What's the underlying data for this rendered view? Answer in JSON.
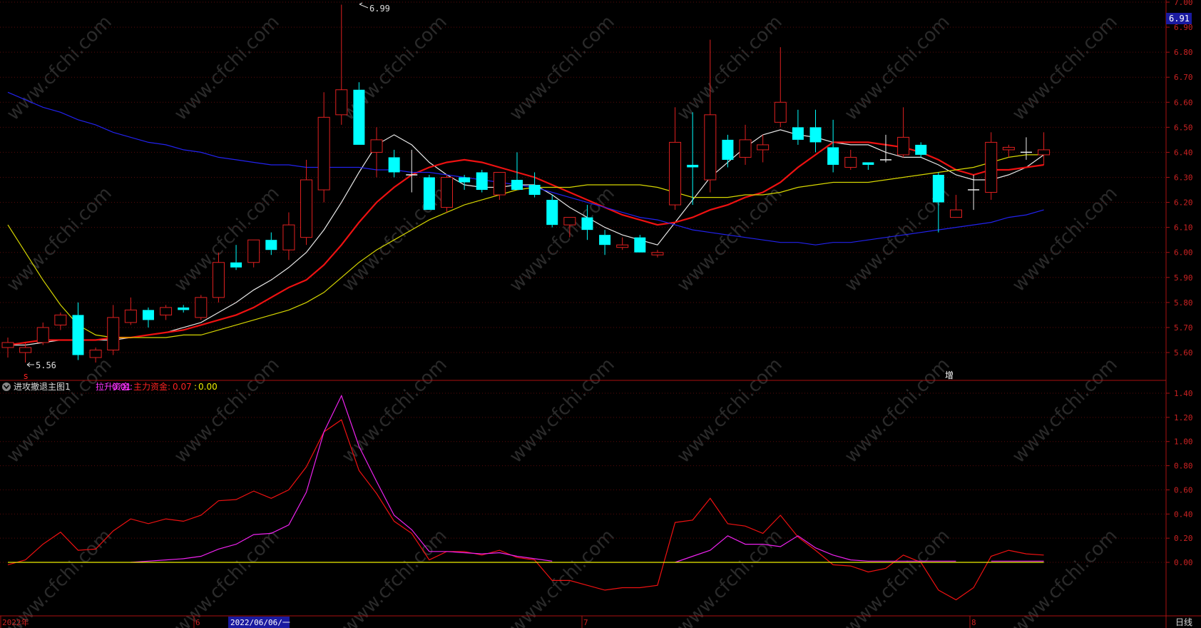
{
  "price_axis": {
    "ticks": [
      "7.00",
      "6.90",
      "6.80",
      "6.70",
      "6.60",
      "6.50",
      "6.40",
      "6.30",
      "6.20",
      "6.10",
      "6.00",
      "5.90",
      "5.80",
      "5.70",
      "5.60"
    ],
    "current_label": "6.91"
  },
  "indicator_axis": {
    "ticks": [
      "1.40",
      "1.20",
      "1.00",
      "0.80",
      "0.60",
      "0.40",
      "0.20",
      "0.00"
    ]
  },
  "annotations": {
    "high_label": "6.99",
    "low_label": "5.56",
    "signal_s": "s",
    "signal_zeng": "增"
  },
  "indicator_header": {
    "name": "进攻撤退主图1",
    "line1_label": "拉升资金:",
    "line1_value": "0.01",
    "line2_label": "主力资金:",
    "line2_value": "0.07",
    "line3_label": ":",
    "line3_value": "0.00"
  },
  "time_axis": {
    "labels": [
      "2022年",
      "6",
      "7",
      "8"
    ],
    "cursor_date": "2022/06/06/一",
    "period": "日线"
  },
  "watermark": "www.cfchi.com",
  "colors": {
    "up": "#e02020",
    "down": "#00ffff",
    "ma_white": "#e8e8e8",
    "ma_red": "#ee1111",
    "ma_yellow": "#d6d600",
    "ma_blue": "#2222ee",
    "ind_magenta": "#ee22ee",
    "ind_red": "#ee1111",
    "ind_yellow": "#eeee00"
  },
  "chart_data": [
    {
      "type": "candlestick",
      "ylim": [
        5.5,
        7.0
      ],
      "candles": [
        {
          "o": 5.62,
          "h": 5.66,
          "l": 5.58,
          "c": 5.64
        },
        {
          "o": 5.6,
          "h": 5.64,
          "l": 5.56,
          "c": 5.62
        },
        {
          "o": 5.64,
          "h": 5.72,
          "l": 5.63,
          "c": 5.7
        },
        {
          "o": 5.71,
          "h": 5.76,
          "l": 5.69,
          "c": 5.75
        },
        {
          "o": 5.75,
          "h": 5.8,
          "l": 5.57,
          "c": 5.59
        },
        {
          "o": 5.58,
          "h": 5.62,
          "l": 5.56,
          "c": 5.61
        },
        {
          "o": 5.61,
          "h": 5.79,
          "l": 5.59,
          "c": 5.74
        },
        {
          "o": 5.72,
          "h": 5.82,
          "l": 5.71,
          "c": 5.77
        },
        {
          "o": 5.77,
          "h": 5.78,
          "l": 5.7,
          "c": 5.73
        },
        {
          "o": 5.75,
          "h": 5.79,
          "l": 5.73,
          "c": 5.78
        },
        {
          "o": 5.78,
          "h": 5.79,
          "l": 5.76,
          "c": 5.77
        },
        {
          "o": 5.74,
          "h": 5.83,
          "l": 5.73,
          "c": 5.82
        },
        {
          "o": 5.82,
          "h": 6.0,
          "l": 5.8,
          "c": 5.96
        },
        {
          "o": 5.96,
          "h": 6.03,
          "l": 5.93,
          "c": 5.94
        },
        {
          "o": 5.96,
          "h": 6.04,
          "l": 5.94,
          "c": 6.05
        },
        {
          "o": 6.05,
          "h": 6.08,
          "l": 5.99,
          "c": 6.01
        },
        {
          "o": 6.01,
          "h": 6.16,
          "l": 5.97,
          "c": 6.11
        },
        {
          "o": 6.06,
          "h": 6.37,
          "l": 6.03,
          "c": 6.29
        },
        {
          "o": 6.25,
          "h": 6.64,
          "l": 6.2,
          "c": 6.54
        },
        {
          "o": 6.55,
          "h": 6.99,
          "l": 6.51,
          "c": 6.65
        },
        {
          "o": 6.65,
          "h": 6.68,
          "l": 6.43,
          "c": 6.43
        },
        {
          "o": 6.4,
          "h": 6.5,
          "l": 6.3,
          "c": 6.45
        },
        {
          "o": 6.38,
          "h": 6.41,
          "l": 6.3,
          "c": 6.32
        },
        {
          "o": 6.31,
          "h": 6.41,
          "l": 6.24,
          "c": 6.31
        },
        {
          "o": 6.3,
          "h": 6.31,
          "l": 6.17,
          "c": 6.17
        },
        {
          "o": 6.18,
          "h": 6.31,
          "l": 6.16,
          "c": 6.3
        },
        {
          "o": 6.3,
          "h": 6.31,
          "l": 6.25,
          "c": 6.28
        },
        {
          "o": 6.32,
          "h": 6.33,
          "l": 6.24,
          "c": 6.25
        },
        {
          "o": 6.23,
          "h": 6.32,
          "l": 6.21,
          "c": 6.32
        },
        {
          "o": 6.29,
          "h": 6.4,
          "l": 6.26,
          "c": 6.25
        },
        {
          "o": 6.27,
          "h": 6.32,
          "l": 6.22,
          "c": 6.23
        },
        {
          "o": 6.21,
          "h": 6.23,
          "l": 6.1,
          "c": 6.11
        },
        {
          "o": 6.11,
          "h": 6.14,
          "l": 6.06,
          "c": 6.14
        },
        {
          "o": 6.14,
          "h": 6.19,
          "l": 6.05,
          "c": 6.09
        },
        {
          "o": 6.07,
          "h": 6.09,
          "l": 5.99,
          "c": 6.03
        },
        {
          "o": 6.02,
          "h": 6.06,
          "l": 6.01,
          "c": 6.03
        },
        {
          "o": 6.06,
          "h": 6.07,
          "l": 6.0,
          "c": 6.0
        },
        {
          "o": 5.99,
          "h": 6.01,
          "l": 5.98,
          "c": 6.0
        },
        {
          "o": 6.19,
          "h": 6.58,
          "l": 6.17,
          "c": 6.44
        },
        {
          "o": 6.35,
          "h": 6.56,
          "l": 6.19,
          "c": 6.34
        },
        {
          "o": 6.29,
          "h": 6.85,
          "l": 6.24,
          "c": 6.55
        },
        {
          "o": 6.45,
          "h": 6.47,
          "l": 6.34,
          "c": 6.37
        },
        {
          "o": 6.38,
          "h": 6.51,
          "l": 6.35,
          "c": 6.45
        },
        {
          "o": 6.41,
          "h": 6.47,
          "l": 6.36,
          "c": 6.43
        },
        {
          "o": 6.52,
          "h": 6.82,
          "l": 6.5,
          "c": 6.6
        },
        {
          "o": 6.5,
          "h": 6.57,
          "l": 6.43,
          "c": 6.45
        },
        {
          "o": 6.5,
          "h": 6.57,
          "l": 6.4,
          "c": 6.44
        },
        {
          "o": 6.42,
          "h": 6.53,
          "l": 6.32,
          "c": 6.35
        },
        {
          "o": 6.34,
          "h": 6.41,
          "l": 6.33,
          "c": 6.38
        },
        {
          "o": 6.36,
          "h": 6.36,
          "l": 6.33,
          "c": 6.35
        },
        {
          "o": 6.37,
          "h": 6.47,
          "l": 6.36,
          "c": 6.37
        },
        {
          "o": 6.39,
          "h": 6.58,
          "l": 6.38,
          "c": 6.46
        },
        {
          "o": 6.43,
          "h": 6.44,
          "l": 6.38,
          "c": 6.39
        },
        {
          "o": 6.31,
          "h": 6.32,
          "l": 6.08,
          "c": 6.2
        },
        {
          "o": 6.14,
          "h": 6.23,
          "l": 6.14,
          "c": 6.17
        },
        {
          "o": 6.25,
          "h": 6.31,
          "l": 6.17,
          "c": 6.25
        },
        {
          "o": 6.24,
          "h": 6.48,
          "l": 6.21,
          "c": 6.44
        },
        {
          "o": 6.41,
          "h": 6.43,
          "l": 6.38,
          "c": 6.42
        },
        {
          "o": 6.4,
          "h": 6.46,
          "l": 6.37,
          "c": 6.4
        },
        {
          "o": 6.39,
          "h": 6.48,
          "l": 6.35,
          "c": 6.41
        }
      ],
      "ma_series": [
        {
          "color_key": "ma_white",
          "values": [
            5.63,
            5.63,
            5.64,
            5.65,
            5.65,
            5.65,
            5.65,
            5.66,
            5.67,
            5.68,
            5.7,
            5.72,
            5.76,
            5.8,
            5.85,
            5.89,
            5.94,
            6.0,
            6.09,
            6.2,
            6.32,
            6.43,
            6.47,
            6.43,
            6.36,
            6.31,
            6.27,
            6.26,
            6.26,
            6.27,
            6.27,
            6.23,
            6.18,
            6.14,
            6.1,
            6.07,
            6.05,
            6.03,
            6.12,
            6.21,
            6.3,
            6.36,
            6.42,
            6.47,
            6.49,
            6.47,
            6.46,
            6.44,
            6.43,
            6.43,
            6.4,
            6.38,
            6.38,
            6.35,
            6.31,
            6.29,
            6.29,
            6.31,
            6.34,
            6.39
          ]
        },
        {
          "color_key": "ma_red",
          "values": [
            5.63,
            5.64,
            5.65,
            5.65,
            5.65,
            5.65,
            5.66,
            5.66,
            5.67,
            5.68,
            5.69,
            5.71,
            5.73,
            5.75,
            5.78,
            5.82,
            5.86,
            5.89,
            5.95,
            6.03,
            6.12,
            6.2,
            6.26,
            6.31,
            6.34,
            6.36,
            6.37,
            6.36,
            6.34,
            6.32,
            6.3,
            6.27,
            6.24,
            6.21,
            6.18,
            6.15,
            6.13,
            6.11,
            6.12,
            6.14,
            6.17,
            6.19,
            6.22,
            6.24,
            6.28,
            6.34,
            6.39,
            6.44,
            6.44,
            6.44,
            6.43,
            6.42,
            6.4,
            6.37,
            6.33,
            6.31,
            6.33,
            6.33,
            6.34,
            6.35
          ]
        },
        {
          "color_key": "ma_yellow",
          "values": [
            6.11,
            6.0,
            5.89,
            5.79,
            5.71,
            5.67,
            5.66,
            5.66,
            5.66,
            5.66,
            5.67,
            5.67,
            5.69,
            5.71,
            5.73,
            5.75,
            5.77,
            5.8,
            5.84,
            5.9,
            5.96,
            6.01,
            6.05,
            6.09,
            6.13,
            6.16,
            6.19,
            6.21,
            6.23,
            6.25,
            6.26,
            6.26,
            6.26,
            6.27,
            6.27,
            6.27,
            6.27,
            6.26,
            6.24,
            6.22,
            6.22,
            6.22,
            6.23,
            6.23,
            6.24,
            6.26,
            6.27,
            6.28,
            6.28,
            6.28,
            6.29,
            6.3,
            6.31,
            6.32,
            6.33,
            6.34,
            6.36,
            6.38,
            6.39,
            6.39
          ]
        },
        {
          "color_key": "ma_blue",
          "values": [
            6.64,
            6.61,
            6.58,
            6.56,
            6.53,
            6.51,
            6.48,
            6.46,
            6.44,
            6.43,
            6.41,
            6.4,
            6.38,
            6.37,
            6.36,
            6.35,
            6.35,
            6.34,
            6.34,
            6.34,
            6.34,
            6.33,
            6.33,
            6.32,
            6.32,
            6.31,
            6.3,
            6.29,
            6.28,
            6.27,
            6.26,
            6.24,
            6.22,
            6.2,
            6.18,
            6.16,
            6.14,
            6.13,
            6.11,
            6.09,
            6.08,
            6.07,
            6.06,
            6.05,
            6.04,
            6.04,
            6.03,
            6.04,
            6.04,
            6.05,
            6.06,
            6.07,
            6.08,
            6.09,
            6.1,
            6.11,
            6.12,
            6.14,
            6.15,
            6.17
          ]
        }
      ]
    },
    {
      "type": "line",
      "title": "进攻撤退主图1",
      "ylim": [
        -0.35,
        1.45
      ],
      "series": [
        {
          "name": "主力资金",
          "color_key": "ind_red",
          "values": [
            -0.02,
            0.02,
            0.15,
            0.25,
            0.1,
            0.11,
            0.26,
            0.36,
            0.32,
            0.36,
            0.34,
            0.39,
            0.51,
            0.52,
            0.59,
            0.53,
            0.6,
            0.79,
            1.08,
            1.18,
            0.76,
            0.57,
            0.34,
            0.24,
            0.02,
            0.09,
            0.09,
            0.06,
            0.1,
            0.04,
            0.02,
            -0.15,
            -0.15,
            -0.19,
            -0.23,
            -0.21,
            -0.21,
            -0.19,
            0.33,
            0.35,
            0.53,
            0.32,
            0.3,
            0.24,
            0.39,
            0.21,
            0.1,
            -0.02,
            -0.03,
            -0.08,
            -0.05,
            0.06,
            0.0,
            -0.23,
            -0.31,
            -0.21,
            0.05,
            0.1,
            0.07,
            0.06
          ]
        },
        {
          "name": "拉升资金",
          "color_key": "ind_magenta",
          "values": [
            null,
            null,
            null,
            null,
            null,
            null,
            null,
            0.0,
            0.01,
            0.02,
            0.03,
            0.05,
            0.11,
            0.15,
            0.23,
            0.24,
            0.31,
            0.58,
            1.08,
            1.38,
            0.96,
            0.67,
            0.39,
            0.27,
            0.09,
            0.09,
            0.08,
            0.07,
            0.08,
            0.05,
            0.03,
            0.01,
            null,
            null,
            null,
            null,
            null,
            null,
            0.0,
            0.05,
            0.1,
            0.22,
            0.15,
            0.15,
            0.13,
            0.22,
            0.12,
            0.06,
            0.02,
            0.01,
            0.01,
            0.01,
            0.01,
            0.01,
            0.01,
            null,
            0.01,
            0.01,
            0.01,
            0.01
          ]
        },
        {
          "name": "",
          "color_key": "ind_yellow",
          "values": [
            0,
            0,
            0,
            0,
            0,
            0,
            0,
            0,
            0,
            0,
            0,
            0,
            0,
            0,
            0,
            0,
            0,
            0,
            0,
            0,
            0,
            0,
            0,
            0,
            0,
            0,
            0,
            0,
            0,
            0,
            0,
            0,
            0,
            0,
            0,
            0,
            0,
            0,
            0,
            0,
            0,
            0,
            0,
            0,
            0,
            0,
            0,
            0,
            0,
            0,
            0,
            0,
            0,
            0,
            0,
            0,
            0,
            0,
            0,
            0
          ]
        }
      ]
    }
  ]
}
